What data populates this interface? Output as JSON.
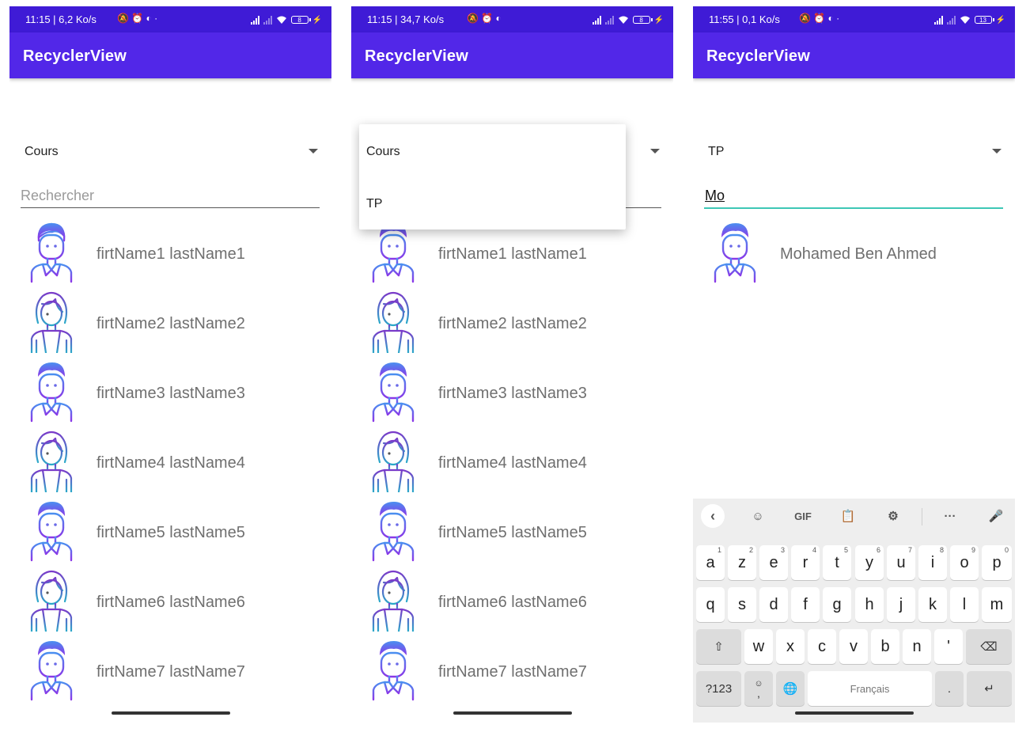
{
  "screens": [
    {
      "status": "11:15 | 6,2 Ko/s",
      "battery": "8",
      "app_title": "RecyclerView",
      "spinner_value": "Cours",
      "search_placeholder": "Rechercher",
      "items": [
        "firtName1 lastName1",
        "firtName2 lastName2",
        "firtName3 lastName3",
        "firtName4 lastName4",
        "firtName5 lastName5",
        "firtName6 lastName6",
        "firtName7 lastName7"
      ]
    },
    {
      "status": "11:15 | 34,7 Ko/s",
      "battery": "8",
      "app_title": "RecyclerView",
      "dropdown_options": [
        "Cours",
        "TP"
      ],
      "items": [
        "firtName1 lastName1",
        "firtName2 lastName2",
        "firtName3 lastName3",
        "firtName4 lastName4",
        "firtName5 lastName5",
        "firtName6 lastName6",
        "firtName7 lastName7"
      ]
    },
    {
      "status": "11:55 | 0,1 Ko/s",
      "battery": "13",
      "app_title": "RecyclerView",
      "spinner_value": "TP",
      "search_value": "Mo",
      "items": [
        "Mohamed Ben Ahmed"
      ],
      "keyboard": {
        "toolbar": [
          "back-chevron-icon",
          "sticker-icon",
          "gif-label",
          "clipboard-icon",
          "settings-icon",
          "more-icon",
          "mic-icon"
        ],
        "gif_label": "GIF",
        "row1": [
          "a",
          "z",
          "e",
          "r",
          "t",
          "y",
          "u",
          "i",
          "o",
          "p"
        ],
        "row1_hints": [
          "1",
          "2",
          "3",
          "4",
          "5",
          "6",
          "7",
          "8",
          "9",
          "0"
        ],
        "row2": [
          "q",
          "s",
          "d",
          "f",
          "g",
          "h",
          "j",
          "k",
          "l",
          "m"
        ],
        "row3": [
          "w",
          "x",
          "c",
          "v",
          "b",
          "n",
          "'"
        ],
        "numbers_key": "?123",
        "emoji_comma": ",",
        "space_label": "Français",
        "period": "."
      }
    }
  ],
  "colors": {
    "status_bar": "#3f1bd6",
    "app_bar": "#5227e8",
    "search_focus": "#3ec7b6"
  }
}
